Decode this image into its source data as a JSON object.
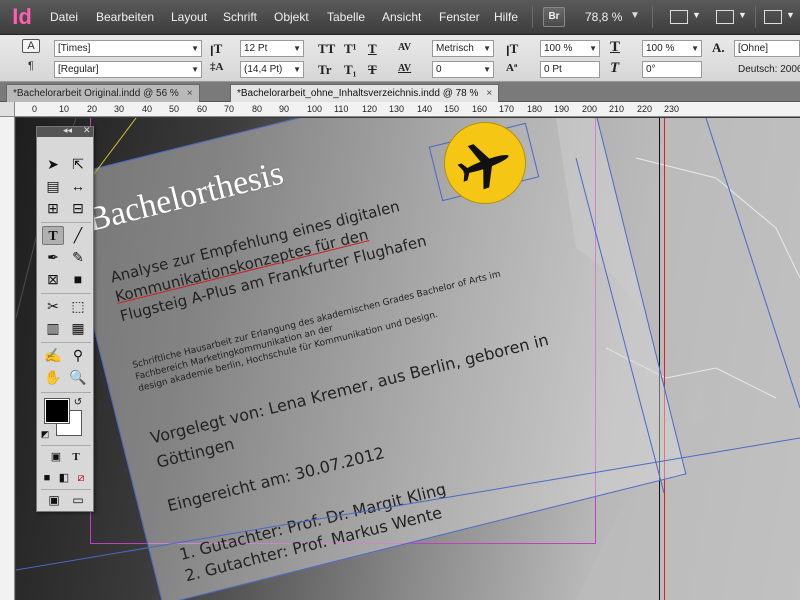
{
  "app": {
    "logo": "Id"
  },
  "menu": [
    "Datei",
    "Bearbeiten",
    "Layout",
    "Schrift",
    "Objekt",
    "Tabelle",
    "Ansicht",
    "Fenster",
    "Hilfe"
  ],
  "bridge_label": "Br",
  "zoom": "78,8 %",
  "control_panel": {
    "font_family": "[Times]",
    "font_style": "[Regular]",
    "font_size": "12 Pt",
    "leading": "(14,4 Pt)",
    "kerning": "Metrisch",
    "tracking": "0",
    "vertical_scale": "100 %",
    "baseline_shift": "0 Pt",
    "horizontal_scale": "100 %",
    "skew": "0°",
    "char_style": "[Ohne]",
    "language": "Deutsch: 2006",
    "caps_glyph": "TT",
    "smallcaps_glyph": "Tr",
    "superscript_glyph": "T¹",
    "subscript_glyph": "T₁",
    "underline_glyph": "T",
    "strike_glyph": "T",
    "para_icon": "¶",
    "char_icon": "A"
  },
  "tabs": [
    {
      "label": "*Bachelorarbeit Original.indd @ 56 %",
      "close": "×"
    },
    {
      "label": "*Bachelorarbeit_ohne_Inhaltsverzeichnis.indd @ 78 %",
      "close": "×"
    }
  ],
  "ruler_h": [
    "0",
    "10",
    "20",
    "30",
    "40",
    "50",
    "60",
    "70",
    "80",
    "90",
    "100",
    "110",
    "120",
    "130",
    "140",
    "150",
    "160",
    "170",
    "180",
    "190",
    "200",
    "210",
    "220",
    "230"
  ],
  "document": {
    "title": "Bachelorthesis",
    "subtitle": [
      "Analyse zur Empfehlung eines digitalen",
      "Kommunikationskonzeptes für den",
      "Flugsteig A-Plus am Frankfurter Flughafen"
    ],
    "description": [
      "Schriftliche Hausarbeit zur Erlangung des akademischen Grades Bachelor of Arts im",
      "Fachbereich Marketingkommunikation an der",
      "design akademie berlin, Hochschule für Kommunikation und Design."
    ],
    "author": [
      "Vorgelegt von: Lena Kremer, aus Berlin, geboren in",
      "Göttingen"
    ],
    "date": "Eingereicht am: 30.07.2012",
    "reviewers": [
      "1. Gutachter: Prof. Dr. Margit Kling",
      "2. Gutachter: Prof. Markus Wente"
    ]
  },
  "colors": {
    "logo_circle": "#f6c615",
    "frame": "#4a68c8",
    "margin_guide": "#c040c0",
    "bleed_guide": "#e02020"
  },
  "tools_icons": [
    "selection-tool",
    "direct-selection-tool",
    "page-tool",
    "gap-tool",
    "content-collector",
    "content-placer",
    "type-tool",
    "line-tool",
    "pen-tool",
    "pencil-tool",
    "rectangle-frame-tool",
    "rectangle-tool",
    "scissors-tool",
    "free-transform-tool",
    "gradient-swatch-tool",
    "gradient-feather-tool",
    "note-tool",
    "eyedropper-tool",
    "hand-tool",
    "zoom-tool"
  ],
  "tools_text_toggle": "T"
}
